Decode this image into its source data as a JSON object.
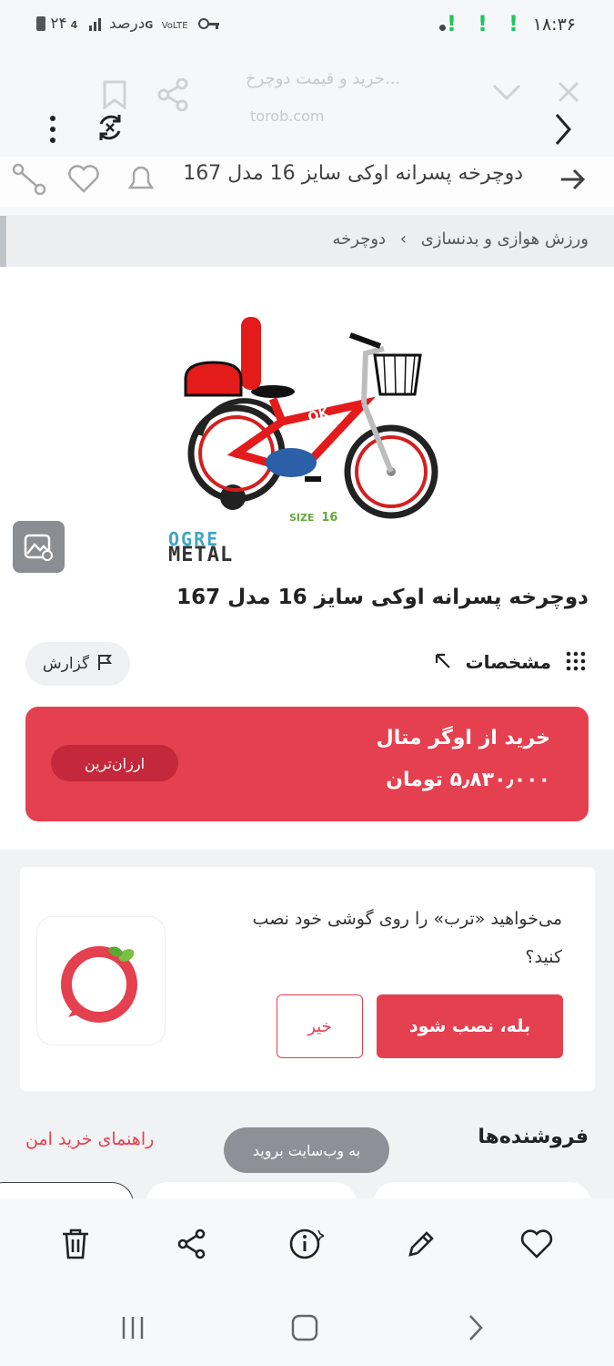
{
  "status_bar": {
    "time": "۱۸:۳۶",
    "battery_text": "۲۴درصد",
    "network_label": "4G"
  },
  "browser": {
    "faded_title": "خرید و قیمت دوچرخ...",
    "faded_url": "torob.com"
  },
  "page": {
    "faded_header_title": "دوچرخه پسرانه اوکی سایز 16 مدل 167"
  },
  "breadcrumb": {
    "items": [
      "ورزش هوازی و بدنسازی",
      "دوچرخه"
    ],
    "separator": "›"
  },
  "product": {
    "size_label": "SIZE",
    "size_value": "16",
    "brand_line1": "OGRE",
    "brand_line2": "METAL",
    "title": "دوچرخه پسرانه اوکی سایز 16 مدل 167",
    "specs_label": "مشخصات",
    "report_label": "گزارش"
  },
  "offer": {
    "store": "خرید از اوگر متال",
    "price": "۵٫۸۳۰٫۰۰۰ تومان",
    "badge": "ارزان‌ترین"
  },
  "install_prompt": {
    "question": "می‌خواهید «ترب» را روی گوشی خود نصب کنید؟",
    "yes_label": "بله، نصب شود",
    "no_label": "خیر"
  },
  "sellers": {
    "title": "فروشنده‌ها",
    "safe_guide_link": "راهنمای خرید امن"
  },
  "toast": {
    "text": "به وب‌سایت بروید"
  },
  "colors": {
    "accent": "#e5404f",
    "badge_dark": "#c4283a",
    "signal_green": "#22c55e"
  }
}
